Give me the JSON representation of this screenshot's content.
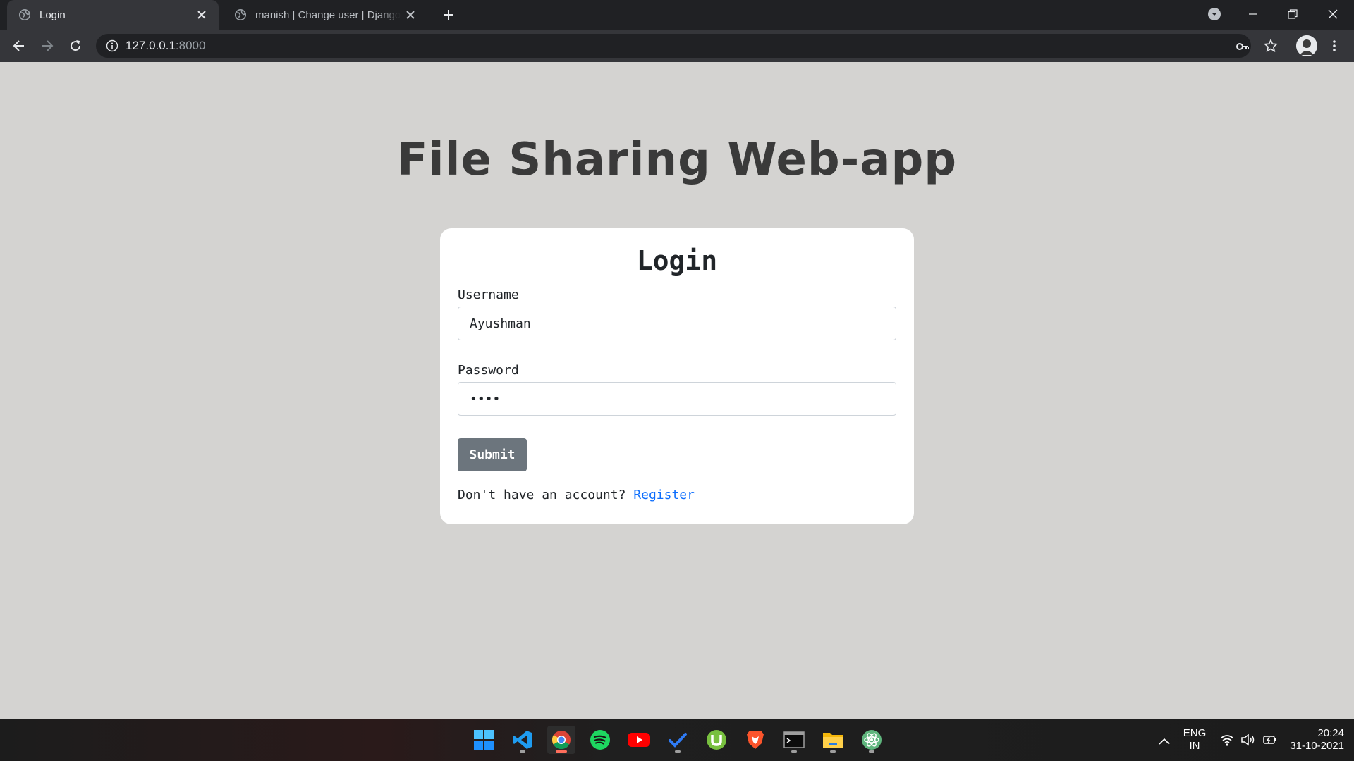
{
  "browser": {
    "tabs": [
      {
        "title": "Login",
        "active": true
      },
      {
        "title": "manish | Change user | Django site admin",
        "active": false
      }
    ],
    "address": {
      "host": "127.0.0.1",
      "port": ":8000"
    }
  },
  "page": {
    "app_title": "File Sharing Web-app",
    "form": {
      "title": "Login",
      "username_label": "Username",
      "username_value": "Ayushman",
      "password_label": "Password",
      "password_value": "abcd",
      "submit_label": "Submit",
      "register_prompt": "Don't have an account?",
      "register_link": "Register"
    }
  },
  "taskbar": {
    "apps": [
      "start-icon",
      "vscode-icon",
      "chrome-icon",
      "spotify-icon",
      "youtube-icon",
      "todo-icon",
      "utorrent-icon",
      "brave-icon",
      "terminal-icon",
      "file-explorer-icon",
      "atom-icon"
    ],
    "language": {
      "line1": "ENG",
      "line2": "IN"
    },
    "clock": {
      "time": "20:24",
      "date": "31-10-2021"
    }
  },
  "colors": {
    "page_bg": "#d4d3d1",
    "card_bg": "#ffffff",
    "submit_bg": "#6c757d",
    "link": "#0d6efd",
    "title_text": "#3a3a3a"
  }
}
